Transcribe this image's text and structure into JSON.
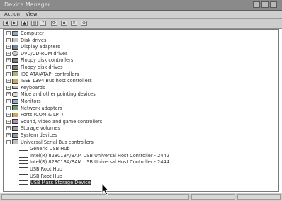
{
  "window": {
    "title": "Device Manager"
  },
  "menu": [
    {
      "label": "Action",
      "name": "menu-action"
    },
    {
      "label": "View",
      "name": "menu-view"
    }
  ],
  "toolbar": {
    "buttons": [
      {
        "name": "back-button",
        "glyph": "◀"
      },
      {
        "name": "forward-button",
        "glyph": "▶"
      },
      {
        "name": "up-button",
        "glyph": "▲"
      },
      {
        "name": "properties-button",
        "glyph": "▤"
      },
      {
        "name": "help-button",
        "glyph": "?"
      },
      {
        "name": "scan-button",
        "glyph": "⟳"
      },
      {
        "name": "update-driver-button",
        "glyph": "◆"
      },
      {
        "name": "uninstall-button",
        "glyph": "✕"
      },
      {
        "name": "disable-button",
        "glyph": "⊘"
      }
    ]
  },
  "tree": {
    "nodes": [
      {
        "label": "Computer",
        "icon": "ico-computer",
        "expander": "+"
      },
      {
        "label": "Disk drives",
        "icon": "ico-disk",
        "expander": "+"
      },
      {
        "label": "Display adapters",
        "icon": "ico-display",
        "expander": "+"
      },
      {
        "label": "DVD/CD-ROM drives",
        "icon": "ico-cd",
        "expander": "+"
      },
      {
        "label": "Floppy disk controllers",
        "icon": "ico-floppy",
        "expander": "+"
      },
      {
        "label": "Floppy disk drives",
        "icon": "ico-floppy",
        "expander": "+"
      },
      {
        "label": "IDE ATA/ATAPI controllers",
        "icon": "ico-ide",
        "expander": "+"
      },
      {
        "label": "IEEE 1394 Bus host controllers",
        "icon": "ico-port",
        "expander": "+"
      },
      {
        "label": "Keyboards",
        "icon": "ico-kbd",
        "expander": "+"
      },
      {
        "label": "Mice and other pointing devices",
        "icon": "ico-mouse",
        "expander": "+"
      },
      {
        "label": "Monitors",
        "icon": "ico-monitor",
        "expander": "+"
      },
      {
        "label": "Network adapters",
        "icon": "ico-net",
        "expander": "+"
      },
      {
        "label": "Ports (COM & LPT)",
        "icon": "ico-port",
        "expander": "+"
      },
      {
        "label": "Sound, video and game controllers",
        "icon": "ico-sound",
        "expander": "+"
      },
      {
        "label": "Storage volumes",
        "icon": "ico-storage",
        "expander": "+"
      },
      {
        "label": "System devices",
        "icon": "ico-system",
        "expander": "+"
      },
      {
        "label": "Universal Serial Bus controllers",
        "icon": "ico-usb",
        "expander": "−"
      }
    ],
    "usb_children": [
      {
        "label": "Generic USB Hub"
      },
      {
        "label": "Intel(R) 82801BA/BAM USB Universal Host Controller - 2442"
      },
      {
        "label": "Intel(R) 82801BA/BAM USB Universal Host Controller - 2444"
      },
      {
        "label": "USB Root Hub"
      },
      {
        "label": "USB Root Hub"
      },
      {
        "label": "USB Mass Storage Device",
        "selected": true
      }
    ]
  }
}
